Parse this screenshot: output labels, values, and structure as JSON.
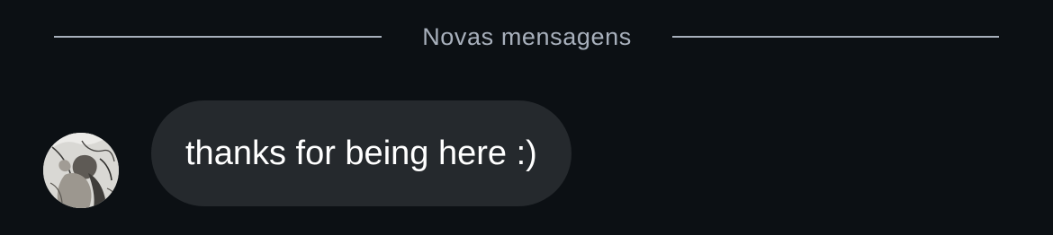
{
  "divider": {
    "label": "Novas mensagens"
  },
  "message": {
    "text": "thanks for being here :)",
    "avatar_icon": "profile-photo-sketch"
  },
  "colors": {
    "background": "#0c1014",
    "bubble": "#25292d",
    "divider": "#a8b0bc",
    "message_text": "#ffffff"
  }
}
